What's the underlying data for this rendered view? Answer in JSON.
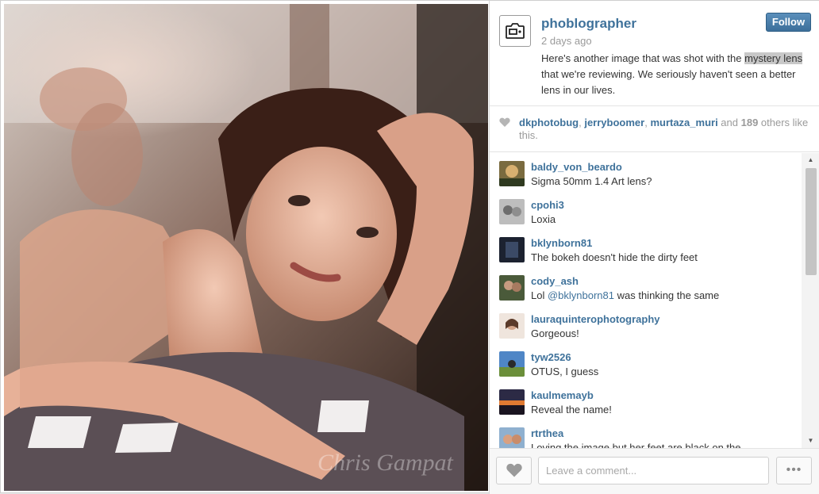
{
  "photo": {
    "alt_icon": "portrait-photo",
    "watermark": "Chris Gampat"
  },
  "post": {
    "owner": "phoblographer",
    "follow_label": "Follow",
    "time": "2 days ago",
    "caption_before": "Here's another image that was shot with the ",
    "caption_highlight": "mystery lens",
    "caption_after": " that we're reviewing. We seriously haven't seen a better lens in our lives."
  },
  "likes": {
    "user1": "dkphotobug",
    "sep1": ", ",
    "user2": "jerryboomer",
    "sep2": ", ",
    "user3": "murtaza_muri",
    "and_text": " and ",
    "count": "189",
    "others_text": " others like this."
  },
  "comments": [
    {
      "user": "baldy_von_beardo",
      "text": "Sigma 50mm 1.4 Art lens?"
    },
    {
      "user": "cpohi3",
      "text": "Loxia"
    },
    {
      "user": "bklynborn81",
      "text": "The bokeh doesn't hide the dirty feet"
    },
    {
      "user": "cody_ash",
      "mention": "@bklynborn81",
      "text": " was thinking the same",
      "prefix": "Lol "
    },
    {
      "user": "lauraquinterophotography",
      "text": "Gorgeous!"
    },
    {
      "user": "tyw2526",
      "text": "OTUS, I guess"
    },
    {
      "user": "kaulmemayb",
      "text": "Reveal the name!"
    },
    {
      "user": "rtrthea",
      "text": "Loving the image but her feet are black on the"
    }
  ],
  "footer": {
    "comment_placeholder": "Leave a comment...",
    "more_label": "•••"
  },
  "colors": {
    "link": "#3f729b",
    "follow_button": "#3d6f9a"
  }
}
